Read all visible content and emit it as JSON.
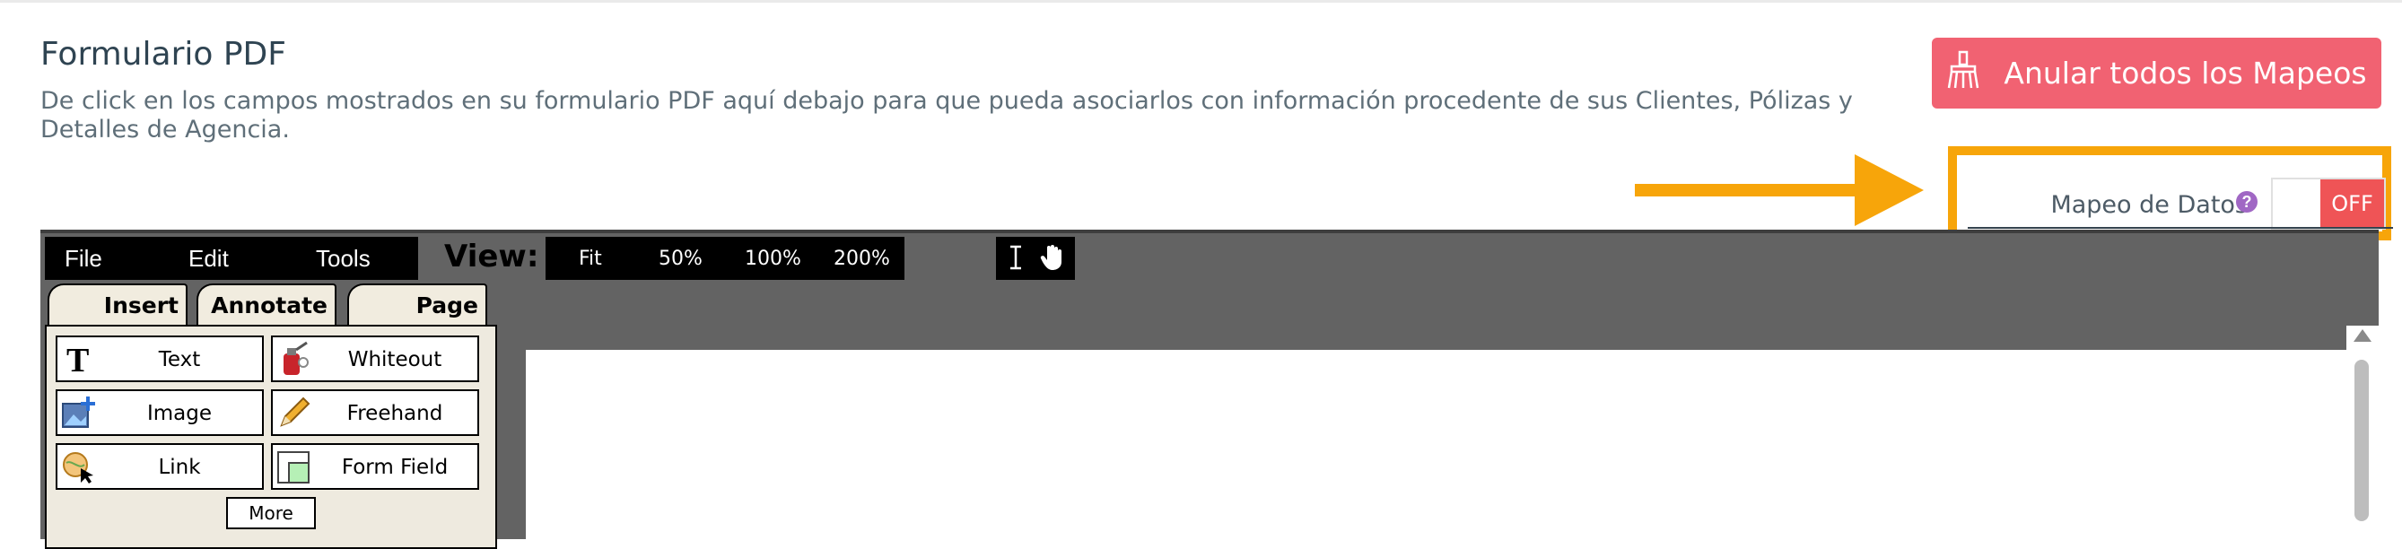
{
  "page": {
    "title": "Formulario PDF",
    "description": "De click en los campos mostrados en su formulario PDF aquí debajo para que pueda asociarlos con información procedente de sus Clientes, Pólizas y Detalles de Agencia."
  },
  "actions": {
    "clear_mappings_label": "Anular todos los Mapeos",
    "clear_mappings_icon": "broom-icon"
  },
  "data_mapping": {
    "label": "Mapeo de Datos",
    "help": "?",
    "toggle_state": "OFF",
    "highlight_color": "#f7a50a"
  },
  "editor": {
    "menu": [
      "File",
      "Edit",
      "Tools"
    ],
    "view_label": "View:",
    "zoom_options": [
      "Fit",
      "50%",
      "100%",
      "200%"
    ],
    "modes": [
      "text-cursor-icon",
      "hand-pointer-icon"
    ],
    "tabs": [
      "Insert",
      "Annotate",
      "Page"
    ],
    "tools": [
      {
        "label": "Text",
        "icon": "text-icon"
      },
      {
        "label": "Whiteout",
        "icon": "whiteout-icon"
      },
      {
        "label": "Image",
        "icon": "image-icon"
      },
      {
        "label": "Freehand",
        "icon": "pencil-icon"
      },
      {
        "label": "Link",
        "icon": "link-icon"
      },
      {
        "label": "Form Field",
        "icon": "form-field-icon"
      }
    ],
    "more_label": "More"
  },
  "colors": {
    "accent_button": "#f16272",
    "toggle_off": "#ef5456",
    "title_text": "#2f4452"
  }
}
